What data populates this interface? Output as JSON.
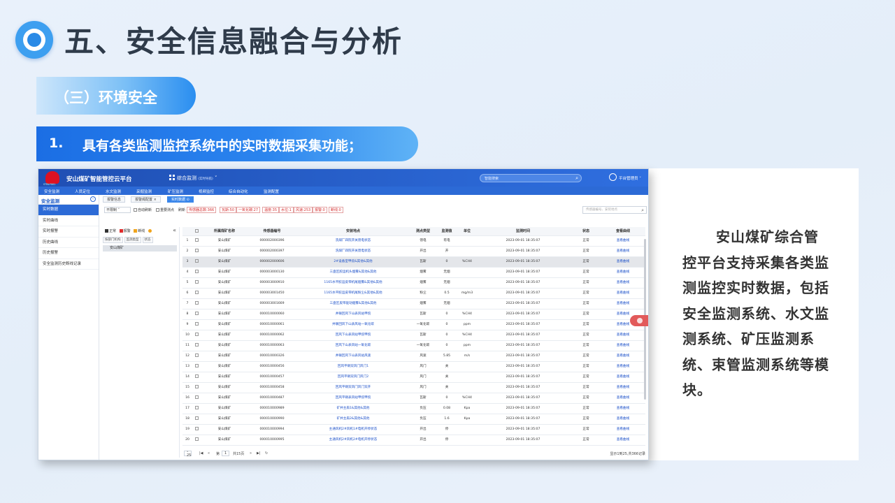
{
  "slide": {
    "title": "五、安全信息融合与分析",
    "section": "（三）环境安全",
    "subheading_number": "1.",
    "subheading_text": "具有各类监测监控系统中的实时数据采集功能；",
    "description": "安山煤矿综合管控平台支持采集各类监测监控实时数据，包括安全监测系统、水文监测系统、矿压监测系统、束管监测系统等模块。"
  },
  "app": {
    "logo_caption": "STBLF001",
    "name": "安山煤矿智能管控云平台",
    "module": "综合监测",
    "module_hint": "(实时导航)",
    "search_placeholder": "智能搜索",
    "search_icon": "search-icon",
    "user": "平台管理员",
    "nav": [
      "安全监测",
      "人员定位",
      "水文监测",
      "采掘监测",
      "矿压监测",
      "视频监控",
      "综合自动化",
      "监测配置"
    ],
    "sidebar": {
      "title": "安全监测",
      "items": [
        "实时数据",
        "实时曲线",
        "实时报警",
        "历史曲线",
        "历史报警",
        "安全监测历史断线记录"
      ]
    },
    "tabs": [
      "报警信息",
      "报警阈配置 ×",
      "实时数据 ⊙"
    ],
    "filter": {
      "select": "不限制",
      "auto_refresh": "自动刷新",
      "important": "重要测点",
      "refresh": "刷新",
      "counts": [
        "传感器总数:366",
        "瓦斯:50",
        "一氧化碳:27",
        "温度:35",
        "水位:1",
        "风速:253",
        "报警:0",
        "断线:0"
      ],
      "search_placeholder": "传感器编号、安装地点"
    },
    "legend": [
      "正常",
      "报警",
      "断线"
    ],
    "tree_tabs": [
      "按部门机构",
      "监测类型",
      "状态"
    ],
    "tree_root": "安山煤矿",
    "columns": [
      "",
      "所属煤矿名称",
      "传感器编号",
      "安装地点",
      "测点类型",
      "监测值",
      "单位",
      "监测时间",
      "状态",
      "查看曲线"
    ],
    "rows": [
      {
        "no": "1",
        "mine": "安山煤矿",
        "code": "000002000396",
        "loc": "洗煤厂四院开关馈电状态",
        "type": "馈电",
        "value": "有电",
        "unit": "",
        "time": "2023-09-01 18:35:07",
        "status": "正常",
        "link": "查看曲线"
      },
      {
        "no": "2",
        "mine": "安山煤矿",
        "code": "000002000397",
        "loc": "洗煤厂四院开关馈电状态",
        "type": "开出",
        "value": "开",
        "unit": "",
        "time": "2023-09-01 18:35:07",
        "status": "正常",
        "link": "查看曲线"
      },
      {
        "no": "3",
        "mine": "安山煤矿",
        "code": "000002000606",
        "loc": "2#设备室甲烷&其他&其他",
        "type": "瓦斯",
        "value": "0",
        "unit": "%CH4",
        "time": "2023-09-01 18:35:07",
        "status": "正常",
        "link": "查看曲线"
      },
      {
        "no": "4",
        "mine": "安山煤矿",
        "code": "000003000130",
        "loc": "三盘区胶运机头烟雾&其他&其他",
        "type": "烟雾",
        "value": "无烟",
        "unit": "",
        "time": "2023-09-01 18:35:07",
        "status": "正常",
        "link": "查看曲线"
      },
      {
        "no": "5",
        "mine": "安山煤矿",
        "code": "000003000910",
        "loc": "1165水平胶运皮带机尾烟雾&其他&其他",
        "type": "烟雾",
        "value": "无烟",
        "unit": "",
        "time": "2023-09-01 18:35:07",
        "status": "正常",
        "link": "查看曲线"
      },
      {
        "no": "6",
        "mine": "安山煤矿",
        "code": "000003001450",
        "loc": "1165水平胶运皮带机尾粉尘&其他&其他",
        "type": "粉尘",
        "value": "0.5",
        "unit": "mg/m3",
        "time": "2023-09-01 18:35:07",
        "status": "正常",
        "link": "查看曲线"
      },
      {
        "no": "7",
        "mine": "安山煤矿",
        "code": "000003001669",
        "loc": "三盘区皮带驱动烟雾&其他&其他",
        "type": "烟雾",
        "value": "无烟",
        "unit": "",
        "time": "2023-09-01 18:35:07",
        "status": "正常",
        "link": "查看曲线"
      },
      {
        "no": "8",
        "mine": "安山煤矿",
        "code": "000010000060",
        "loc": "井联回风下山表风站甲烷",
        "type": "瓦斯",
        "value": "0",
        "unit": "%CH4",
        "time": "2023-09-01 18:35:07",
        "status": "正常",
        "link": "查看曲线"
      },
      {
        "no": "9",
        "mine": "安山煤矿",
        "code": "000010000061",
        "loc": "井联回风下山表风站一氧化碳",
        "type": "一氧化碳",
        "value": "0",
        "unit": "ppm",
        "time": "2023-09-01 18:35:07",
        "status": "正常",
        "link": "查看曲线"
      },
      {
        "no": "10",
        "mine": "安山煤矿",
        "code": "000010000062",
        "loc": "回风下山表风站甲烷甲烷",
        "type": "瓦斯",
        "value": "0",
        "unit": "%CH4",
        "time": "2023-09-01 18:35:07",
        "status": "正常",
        "link": "查看曲线"
      },
      {
        "no": "11",
        "mine": "安山煤矿",
        "code": "000010000063",
        "loc": "回风下山表风站一氧化碳",
        "type": "一氧化碳",
        "value": "0",
        "unit": "ppm",
        "time": "2023-09-01 18:35:07",
        "status": "正常",
        "link": "查看曲线"
      },
      {
        "no": "12",
        "mine": "安山煤矿",
        "code": "000010000326",
        "loc": "井联回风下山表风站风速",
        "type": "风速",
        "value": "5.85",
        "unit": "m/s",
        "time": "2023-09-01 18:35:07",
        "status": "正常",
        "link": "查看曲线"
      },
      {
        "no": "13",
        "mine": "安山煤矿",
        "code": "000010000456",
        "loc": "回风平硐双风门风门1",
        "type": "风门",
        "value": "关",
        "unit": "",
        "time": "2023-09-01 18:35:07",
        "status": "正常",
        "link": "查看曲线"
      },
      {
        "no": "14",
        "mine": "安山煤矿",
        "code": "000010000457",
        "loc": "回风平硐双风门风门2",
        "type": "风门",
        "value": "关",
        "unit": "",
        "time": "2023-09-01 18:35:07",
        "status": "正常",
        "link": "查看曲线"
      },
      {
        "no": "15",
        "mine": "安山煤矿",
        "code": "000010000458",
        "loc": "回风平硐双风门风门双开",
        "type": "风门",
        "value": "关",
        "unit": "",
        "time": "2023-09-01 18:35:07",
        "status": "正常",
        "link": "查看曲线"
      },
      {
        "no": "16",
        "mine": "安山煤矿",
        "code": "000010000487",
        "loc": "回风平硐表风站甲烷甲烷",
        "type": "瓦斯",
        "value": "0",
        "unit": "%CH4",
        "time": "2023-09-01 18:35:07",
        "status": "正常",
        "link": "查看曲线"
      },
      {
        "no": "17",
        "mine": "安山煤矿",
        "code": "000010000989",
        "loc": "矿井主扇1&其他&其他",
        "type": "负压",
        "value": "0.08",
        "unit": "Kpa",
        "time": "2023-09-01 18:35:07",
        "status": "正常",
        "link": "查看曲线"
      },
      {
        "no": "18",
        "mine": "安山煤矿",
        "code": "000010000990",
        "loc": "矿井主扇2&其他&其他",
        "type": "负压",
        "value": "1.6",
        "unit": "Kpa",
        "time": "2023-09-01 18:35:07",
        "status": "正常",
        "link": "查看曲线"
      },
      {
        "no": "19",
        "mine": "安山煤矿",
        "code": "000010000994",
        "loc": "主通风机2#风机1#电机开停状态",
        "type": "开出",
        "value": "停",
        "unit": "",
        "time": "2023-09-01 18:35:07",
        "status": "正常",
        "link": "查看曲线"
      },
      {
        "no": "20",
        "mine": "安山煤矿",
        "code": "000010000995",
        "loc": "主通风机2#风机2#电机开停状态",
        "type": "开出",
        "value": "停",
        "unit": "",
        "time": "2023-09-01 18:35:07",
        "status": "正常",
        "link": "查看曲线"
      }
    ],
    "pager": {
      "page_size": "25",
      "page_label": "第",
      "page": "1",
      "total_pages": "共15页",
      "summary": "显示1到25,共366记录"
    }
  }
}
